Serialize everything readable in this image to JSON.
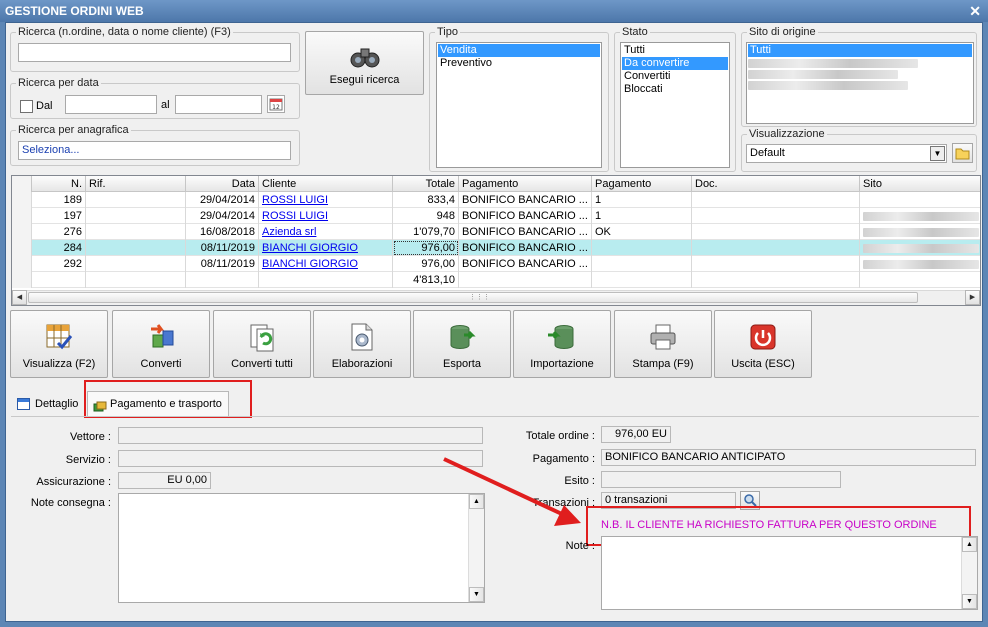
{
  "window": {
    "title": "GESTIONE ORDINI WEB",
    "close_glyph": "✕"
  },
  "search": {
    "legend": "Ricerca (n.ordine, data o nome cliente) (F3)",
    "value": "",
    "by_date_legend": "Ricerca per data",
    "from_label": "Dal",
    "to_label": "al",
    "from_value": "",
    "to_value": "",
    "by_registry_legend": "Ricerca per anagrafica",
    "registry_value": "Seleziona...",
    "run_button": "Esegui ricerca"
  },
  "tipo": {
    "legend": "Tipo",
    "items": [
      "Vendita",
      "Preventivo"
    ],
    "selected": "Vendita"
  },
  "stato": {
    "legend": "Stato",
    "items": [
      "Tutti",
      "Da convertire",
      "Convertiti",
      "Bloccati"
    ],
    "selected": "Da convertire"
  },
  "sito": {
    "legend": "Sito di origine",
    "first": "Tutti"
  },
  "view": {
    "legend": "Visualizzazione",
    "value": "Default"
  },
  "grid": {
    "columns": [
      "N.",
      "Rif.",
      "Data",
      "Cliente",
      "Totale",
      "Pagamento",
      "Pagamento",
      "Doc.",
      "Sito"
    ],
    "rows": [
      {
        "n": "189",
        "rif": "",
        "data": "29/04/2014",
        "cliente": "ROSSI LUIGI",
        "totale": "833,4",
        "pagamento": "BONIFICO BANCARIO ...",
        "pagamento2": "1",
        "doc": ""
      },
      {
        "n": "197",
        "rif": "",
        "data": "29/04/2014",
        "cliente": "ROSSI LUIGI",
        "totale": "948",
        "pagamento": "BONIFICO BANCARIO ...",
        "pagamento2": "1",
        "doc": ""
      },
      {
        "n": "276",
        "rif": "",
        "data": "16/08/2018",
        "cliente": "Azienda srl",
        "totale": "1'079,70",
        "pagamento": "BONIFICO BANCARIO ...",
        "pagamento2": "OK",
        "doc": ""
      },
      {
        "n": "284",
        "rif": "",
        "data": "08/11/2019",
        "cliente": "BIANCHI GIORGIO",
        "totale": "976,00",
        "pagamento": "BONIFICO BANCARIO ...",
        "pagamento2": "",
        "doc": ""
      },
      {
        "n": "292",
        "rif": "",
        "data": "08/11/2019",
        "cliente": "BIANCHI GIORGIO",
        "totale": "976,00",
        "pagamento": "BONIFICO BANCARIO ...",
        "pagamento2": "",
        "doc": ""
      }
    ],
    "total": "4'813,10",
    "selected_row": 3
  },
  "toolbar": {
    "visualizza": "Visualizza (F2)",
    "converti": "Converti",
    "converti_tutti": "Converti tutti",
    "elaborazioni": "Elaborazioni",
    "esporta": "Esporta",
    "importazione": "Importazione",
    "stampa": "Stampa (F9)",
    "uscita": "Uscita (ESC)"
  },
  "tabs": {
    "dettaglio": "Dettaglio",
    "pagamento": "Pagamento e trasporto"
  },
  "detail": {
    "vettore_label": "Vettore :",
    "servizio_label": "Servizio :",
    "assicurazione_label": "Assicurazione :",
    "assicurazione_value": "EU 0,00",
    "note_consegna_label": "Note consegna :",
    "totale_label": "Totale ordine :",
    "totale_value": "976,00 EU",
    "pagamento_label": "Pagamento :",
    "pagamento_value": "BONIFICO BANCARIO ANTICIPATO",
    "esito_label": "Esito :",
    "transazioni_label": "Transazioni :",
    "transazioni_value": "0 transazioni",
    "note_label": "Note :",
    "note_value": "N.B. IL CLIENTE HA RICHIESTO FATTURA PER QUESTO ORDINE"
  },
  "colors": {
    "highlight": "#e01e1e",
    "note_text": "#c800c8",
    "selection": "#3399ff"
  }
}
